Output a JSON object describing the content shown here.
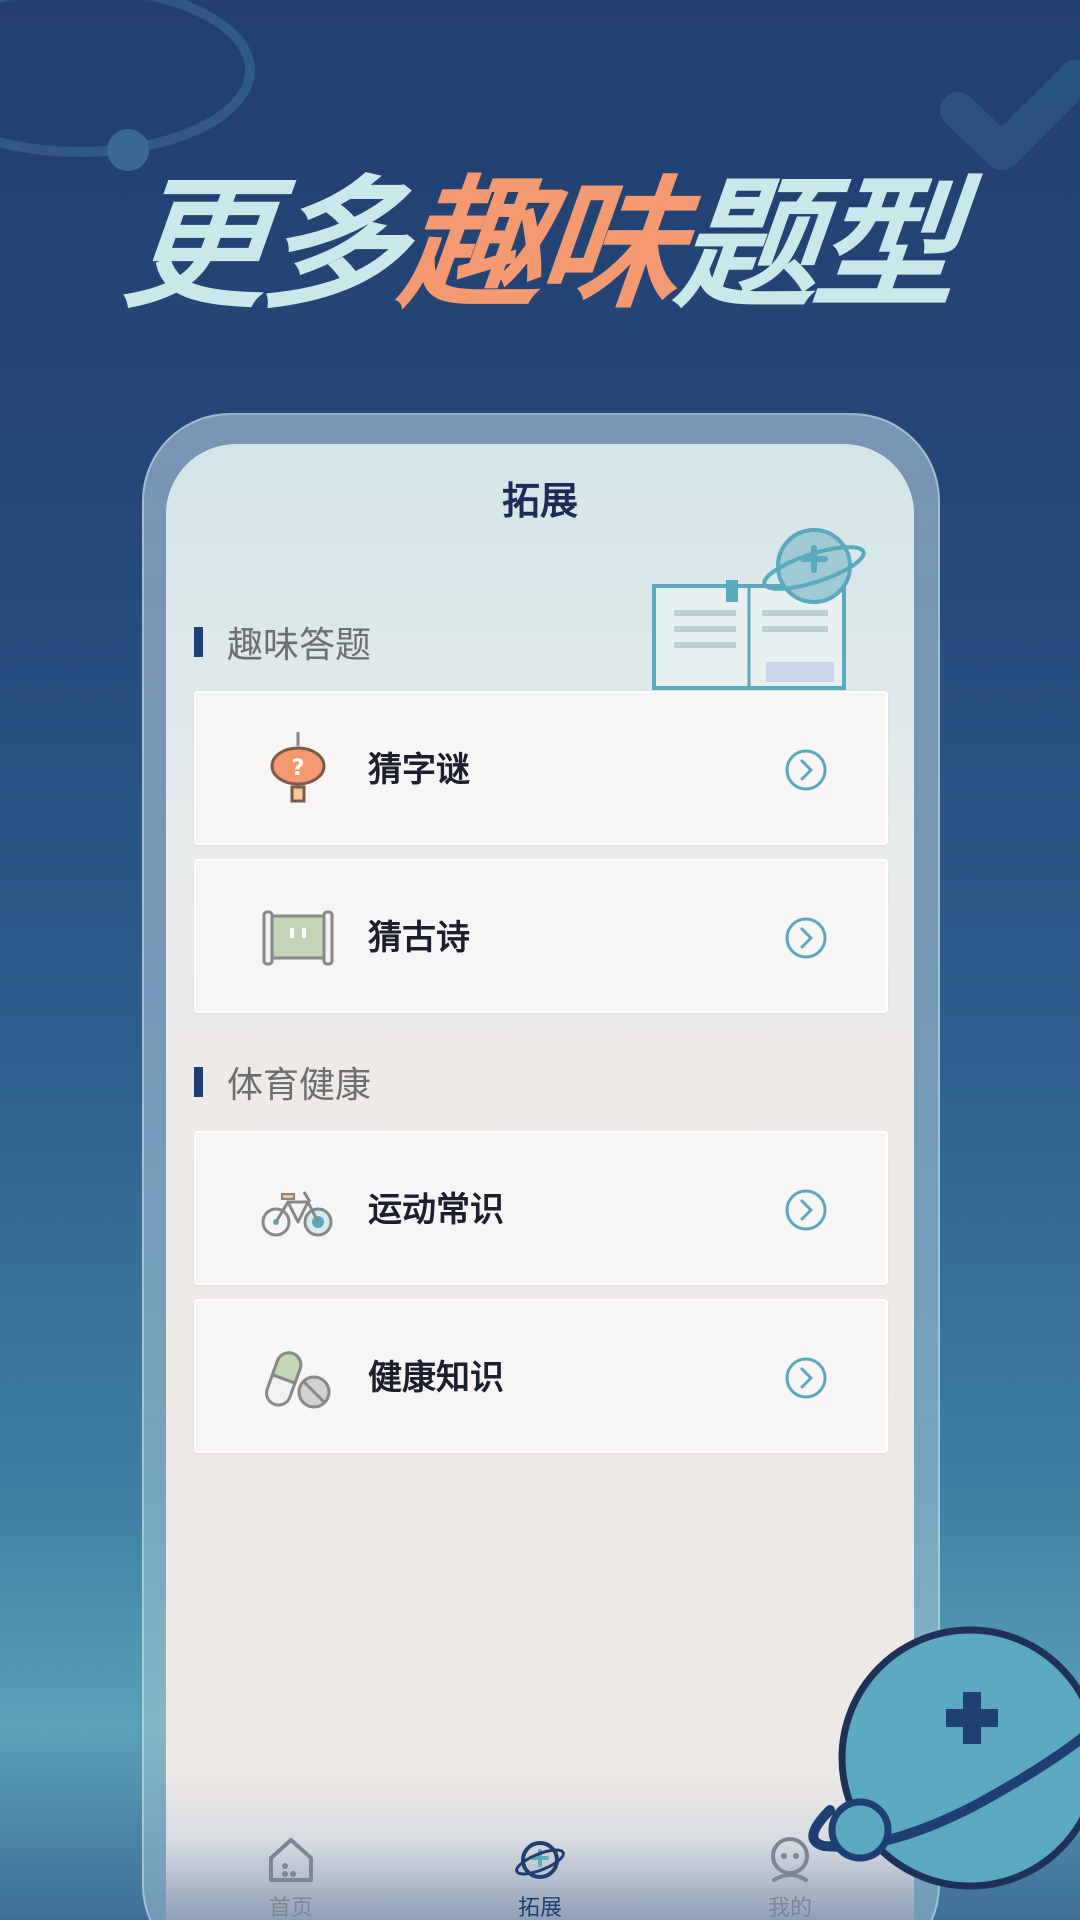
{
  "headline": {
    "part1": "更多",
    "part2": "趣味",
    "part3": "题型"
  },
  "screen": {
    "title": "拓展",
    "sections": [
      {
        "label": "趣味答题",
        "items": [
          {
            "label": "猜字谜",
            "icon": "lantern-icon"
          },
          {
            "label": "猜古诗",
            "icon": "scroll-icon"
          }
        ]
      },
      {
        "label": "体育健康",
        "items": [
          {
            "label": "运动常识",
            "icon": "bicycle-icon"
          },
          {
            "label": "健康知识",
            "icon": "pills-icon"
          }
        ]
      }
    ]
  },
  "tabbar": {
    "tabs": [
      {
        "label": "首页",
        "icon": "home-icon",
        "active": false
      },
      {
        "label": "拓展",
        "icon": "planet-icon",
        "active": true
      },
      {
        "label": "我的",
        "icon": "profile-icon",
        "active": false
      }
    ]
  },
  "colors": {
    "background": "#223f6f",
    "accent": "#f59a70",
    "headline": "#c8e8ea",
    "teal": "#5aa9be",
    "navy": "#1f3f73"
  }
}
